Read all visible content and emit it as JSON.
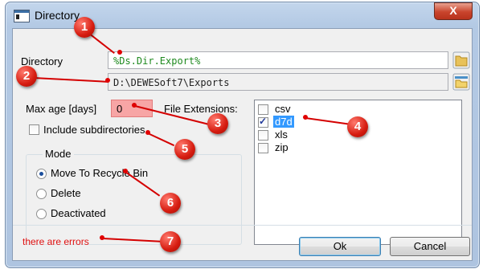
{
  "window": {
    "title": "Directory",
    "close_glyph": "X"
  },
  "directory": {
    "label": "Directory",
    "value": "%Ds.Dir.Export%",
    "resolved_value": "D:\\DEWESoft7\\Exports"
  },
  "options": {
    "max_age_label": "Max age [days]",
    "max_age_value": "0",
    "include_subdirs_label": "Include subdirectories",
    "include_subdirs_checked": false
  },
  "mode": {
    "title": "Mode",
    "items": [
      {
        "label": "Move To Recycle Bin",
        "selected": true
      },
      {
        "label": "Delete",
        "selected": false
      },
      {
        "label": "Deactivated",
        "selected": false
      }
    ]
  },
  "extensions": {
    "label": "File Extensions:",
    "items": [
      {
        "label": "csv",
        "checked": false,
        "selected": false
      },
      {
        "label": "d7d",
        "checked": true,
        "selected": true
      },
      {
        "label": "xls",
        "checked": false,
        "selected": false
      },
      {
        "label": "zip",
        "checked": false,
        "selected": false
      }
    ]
  },
  "footer": {
    "error_text": "there are errors",
    "ok_label": "Ok",
    "cancel_label": "Cancel"
  },
  "annotations": [
    "1",
    "2",
    "3",
    "4",
    "5",
    "6",
    "7"
  ],
  "colors": {
    "annotation": "#d61c10",
    "error_field": "#f7a5a5",
    "error_text": "#e01010",
    "path_text": "#1f8a1f",
    "selection": "#3399ff"
  }
}
